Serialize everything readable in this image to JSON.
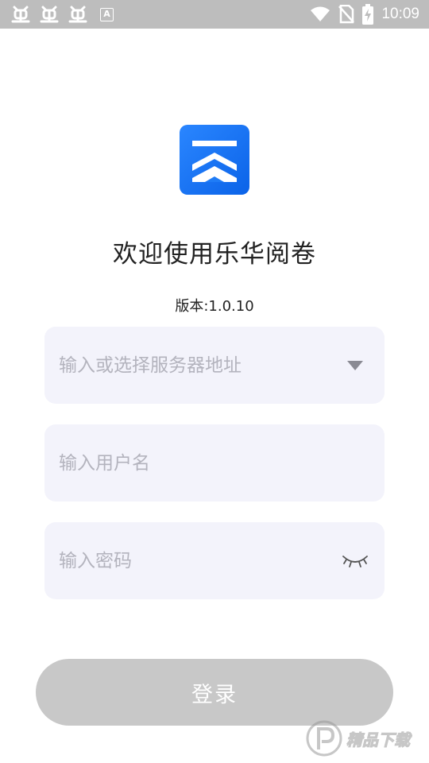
{
  "status_bar": {
    "time": "10:09",
    "left_icons": [
      "bug-icon",
      "bug-icon",
      "bug-icon",
      "a-box-icon"
    ],
    "right_icons": [
      "wifi-icon",
      "no-sim-icon",
      "battery-charging-icon"
    ],
    "a_box_letter": "A"
  },
  "app": {
    "logo_icon": "app-logo-icon",
    "title": "欢迎使用乐华阅卷",
    "version": "版本:1.0.10"
  },
  "form": {
    "server": {
      "placeholder": "输入或选择服务器地址",
      "value": ""
    },
    "username": {
      "placeholder": "输入用户名",
      "value": ""
    },
    "password": {
      "placeholder": "输入密码",
      "value": ""
    },
    "login_label": "登录"
  },
  "watermark": {
    "text": "精品下载"
  },
  "colors": {
    "status_bar": "#bdbdbd",
    "logo_blue": "#1976f2",
    "field_bg": "#f3f3fb",
    "button_disabled": "#c8c8c8",
    "placeholder": "#b3b3bd"
  }
}
